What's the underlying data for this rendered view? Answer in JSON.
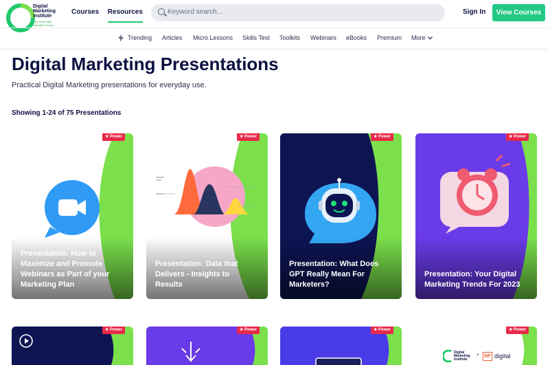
{
  "logo": {
    "line1": "Digital",
    "line2": "Marketing",
    "line3": "Institute",
    "sub": "Part of the IIMC Education Group"
  },
  "nav": {
    "courses": "Courses",
    "resources": "Resources"
  },
  "search": {
    "placeholder": "Keyword search..."
  },
  "header": {
    "signin": "Sign In",
    "view_courses": "View Courses"
  },
  "subnav": [
    "Trending",
    "Articles",
    "Micro Lessons",
    "Skills Test",
    "Toolkits",
    "Webinars",
    "eBooks",
    "Premium",
    "More"
  ],
  "page": {
    "title": "Digital Marketing Presentations",
    "description": "Practical Digital Marketing presentations for everyday use.",
    "count": "Showing 1-24 of 75 Presentations"
  },
  "badge_label": "★ Power",
  "cards": [
    {
      "title": "Presentation: How to Maximize and Promote Webinars as Part of your Marketing Plan",
      "icon": "video-chat-icon"
    },
    {
      "title": "Presentation: Data that Delivers - Insights to Results",
      "icon": "distribution-chart-icon"
    },
    {
      "title": "Presentation: What Does GPT Really Mean For Marketers?",
      "icon": "robot-icon"
    },
    {
      "title": "Presentation: Your Digital Marketing Trends For 2023",
      "icon": "alarm-clock-icon"
    }
  ],
  "bottom_cards": [
    {
      "icon": "play-icon"
    },
    {
      "icon": "download-arrows-icon"
    },
    {
      "icon": "laptop-icon"
    },
    {
      "logo_text": "Digital Marketing Institute",
      "x_text": "×",
      "partner": "digital"
    }
  ]
}
